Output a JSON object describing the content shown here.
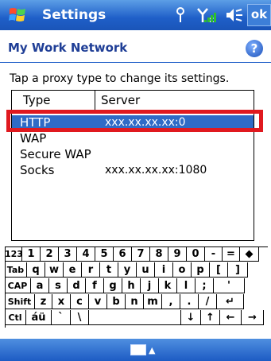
{
  "titlebar": {
    "title": "Settings",
    "ok_label": "ok"
  },
  "header": {
    "title": "My Work Network",
    "help": "?"
  },
  "instruction": "Tap a proxy type to change its settings.",
  "list": {
    "columns": [
      "Type",
      "Server"
    ],
    "rows": [
      {
        "type": "HTTP",
        "server": "xxx.xx.xx.xx:0",
        "selected": true
      },
      {
        "type": "WAP",
        "server": ""
      },
      {
        "type": "Secure WAP",
        "server": ""
      },
      {
        "type": "Socks",
        "server": "xxx.xx.xx.xx:1080"
      }
    ]
  },
  "keyboard": {
    "row1": [
      "123",
      "1",
      "2",
      "3",
      "4",
      "5",
      "6",
      "7",
      "8",
      "9",
      "0",
      "-",
      "=",
      "◆"
    ],
    "row2": [
      "Tab",
      "q",
      "w",
      "e",
      "r",
      "t",
      "y",
      "u",
      "i",
      "o",
      "p",
      "[",
      "]"
    ],
    "row3": [
      "CAP",
      "a",
      "s",
      "d",
      "f",
      "g",
      "h",
      "j",
      "k",
      "l",
      ";",
      "'"
    ],
    "row4": [
      "Shift",
      "z",
      "x",
      "c",
      "v",
      "b",
      "n",
      "m",
      ",",
      ".",
      "/",
      "↵"
    ],
    "row5": [
      "Ctl",
      "áü",
      "`",
      "\\",
      "",
      "↓",
      "↑",
      "←",
      "→"
    ]
  },
  "colors": {
    "titlebar": "#1f5fc8",
    "selection": "#2f6bc6",
    "highlight_outline": "#e0191f"
  }
}
